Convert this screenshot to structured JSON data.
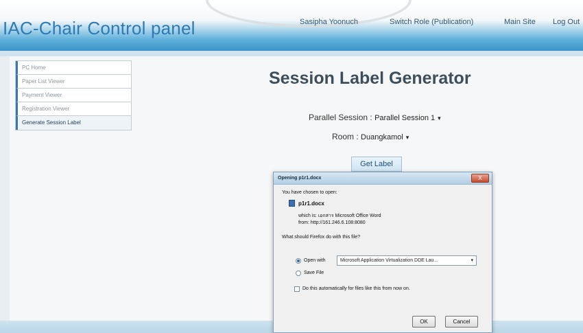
{
  "header": {
    "title": "IAC-Chair Control panel",
    "nav": {
      "user": "Sasipha Yoonuch",
      "switch_role": "Switch Role (Publication)",
      "main_site": "Main Site",
      "logout": "Log Out"
    }
  },
  "sidebar": {
    "items": [
      {
        "label": "PC Home"
      },
      {
        "label": "Paper List Viewer"
      },
      {
        "label": "Payment Viewer"
      },
      {
        "label": "Registration Viewer"
      },
      {
        "label": "Generate Session Label"
      }
    ],
    "active_index": 4
  },
  "main": {
    "title": "Session Label Generator",
    "parallel_session_label": "Parallel Session :",
    "parallel_session_value": "Parallel Session 1",
    "room_label": "Room :",
    "room_value": "Duangkamol",
    "get_label_button": "Get Label"
  },
  "dialog": {
    "title": "Opening p1r1.docx",
    "close_label": "X",
    "intro": "You have chosen to open:",
    "filename": "p1r1.docx",
    "which_is": "which is: เอกสาร Microsoft Office Word",
    "from": "from: http://161.246.6.108:8080",
    "question": "What should Firefox do with this file?",
    "open_with_label": "Open with",
    "open_with_app": "Microsoft Application Virtualization DDE Lau...",
    "save_file_label": "Save File",
    "auto_label": "Do this automatically for files like this from now on.",
    "ok_label": "OK",
    "cancel_label": "Cancel",
    "open_with_selected": true,
    "auto_checked": false
  },
  "colors": {
    "accent": "#2d7bb4",
    "header_gradient_bottom": "#3a94c8"
  }
}
